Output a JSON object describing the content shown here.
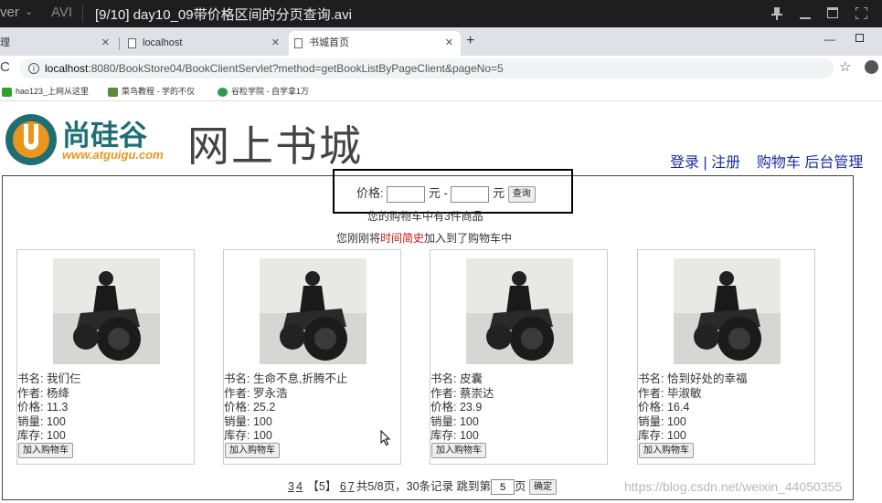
{
  "player": {
    "app_fragment": "ver",
    "format": "AVI",
    "title": "[9/10] day10_09带价格区间的分页查询.avi"
  },
  "browser": {
    "tabs": [
      {
        "label": "理",
        "active": false
      },
      {
        "label": "localhost",
        "active": false
      },
      {
        "label": "书城首页",
        "active": true
      }
    ],
    "url_host": "localhost",
    "url_path": ":8080/BookStore04/BookClientServlet?method=getBookListByPageClient&pageNo=5",
    "bookmarks": [
      {
        "label": "hao123_上网从这里",
        "color": "#2aa52a"
      },
      {
        "label": "菜鸟教程 - 学的不仅",
        "color": "#5a8a3c"
      },
      {
        "label": "谷粒学院 - 自学拿1万",
        "color": "#2a9d4a"
      }
    ]
  },
  "page": {
    "logo_cn": "尚硅谷",
    "logo_url": "www.atguigu.com",
    "site_title": "网上书城",
    "nav": {
      "login": "登录",
      "separator": "|",
      "register": "注册",
      "cart": "购物车",
      "admin": "后台管理"
    },
    "filter": {
      "price_label": "价格:",
      "min_value": "",
      "dash": "元 -",
      "max_value": "",
      "unit": "元",
      "query_button": "查询"
    },
    "cart_count_text": "您的购物车中有3件商品",
    "last_added": {
      "prefix": "您刚刚将",
      "book": "时间简史",
      "suffix": "加入到了购物车中"
    },
    "books": [
      {
        "name": "书名: 我们仨",
        "author": "作者: 杨绛",
        "price": "价格: 11.3",
        "sales": "销量: 100",
        "stock": "库存: 100",
        "button": "加入购物车"
      },
      {
        "name": "书名: 生命不息,折腾不止",
        "author": "作者: 罗永浩",
        "price": "价格: 25.2",
        "sales": "销量: 100",
        "stock": "库存: 100",
        "button": "加入购物车"
      },
      {
        "name": "书名: 皮囊",
        "author": "作者: 蔡崇达",
        "price": "价格: 23.9",
        "sales": "销量: 100",
        "stock": "库存: 100",
        "button": "加入购物车"
      },
      {
        "name": "书名: 恰到好处的幸福",
        "author": "作者: 毕淑敏",
        "price": "价格: 16.4",
        "sales": "销量: 100",
        "stock": "库存: 100",
        "button": "加入购物车"
      }
    ],
    "pager": {
      "links_before": [
        "3",
        "4"
      ],
      "current": "【5】",
      "links_after": [
        "6",
        "7"
      ],
      "summary": "共5/8页，30条记录 跳到第",
      "jump_value": "5",
      "page_unit": "页",
      "confirm_button": "确定"
    },
    "watermark": "https://blog.csdn.net/weixin_44050355"
  },
  "colors": {
    "link_blue": "#1a2ba0",
    "highlight_red": "#d01010",
    "logo_orange": "#e8961e",
    "logo_teal": "#1f6e73"
  }
}
